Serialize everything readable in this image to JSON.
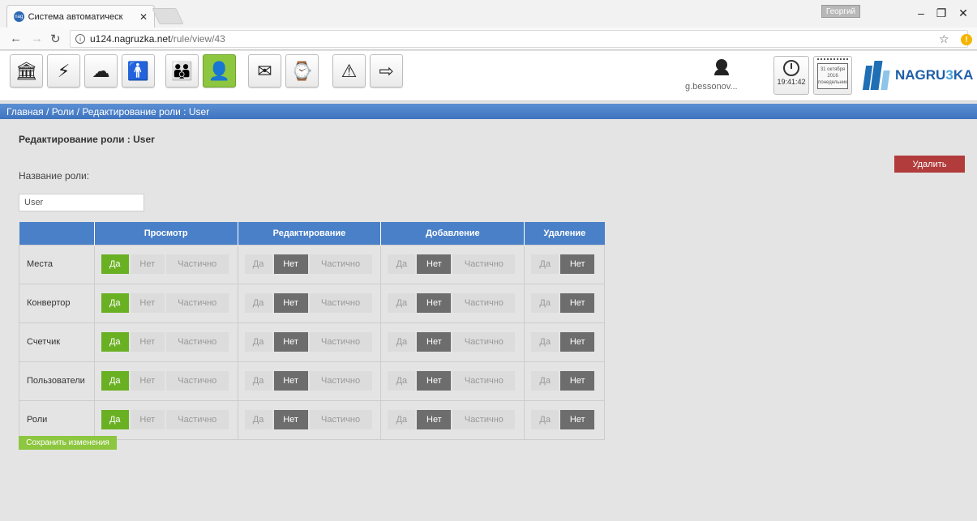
{
  "browser": {
    "tab_title": "Система автоматическ",
    "tab_favicon": "nag",
    "user_chip": "Георгий",
    "url_host": "u124.nagruzka.net",
    "url_path": "/rule/view/43"
  },
  "toolbar": {
    "icons": [
      "building-icon",
      "network-icon",
      "cloud-network-icon",
      "person-icon",
      "family-icon",
      "roles-icon",
      "mail-icon",
      "schedule-icon",
      "warning-icon",
      "logout-icon"
    ],
    "active_index": 5,
    "username": "g.bessonov...",
    "time": "19:41:42",
    "calendar_day": "31 октября",
    "calendar_year": "2016",
    "calendar_weekday": "понедельник",
    "logo_text_main": "NAGRU",
    "logo_text_accent": "3",
    "logo_text_end": "KA"
  },
  "breadcrumb": {
    "home": "Главная",
    "sep": " / ",
    "roles": "Роли",
    "current": "Редактирование роли : User"
  },
  "page": {
    "title": "Редактирование роли : User",
    "delete_label": "Удалить",
    "role_name_label": "Название роли:",
    "role_name_value": "User",
    "save_label": "Сохранить изменения"
  },
  "table": {
    "headers": [
      "",
      "Просмотр",
      "Редактирование",
      "Добавление",
      "Удаление"
    ],
    "labels": {
      "yes": "Да",
      "no": "Нет",
      "partial": "Частично"
    },
    "rows": [
      {
        "name": "Места",
        "view": "yes",
        "edit": "no",
        "add": "no",
        "delete": "no"
      },
      {
        "name": "Конвертор",
        "view": "yes",
        "edit": "no",
        "add": "no",
        "delete": "no"
      },
      {
        "name": "Счетчик",
        "view": "yes",
        "edit": "no",
        "add": "no",
        "delete": "no"
      },
      {
        "name": "Пользователи",
        "view": "yes",
        "edit": "no",
        "add": "no",
        "delete": "no"
      },
      {
        "name": "Роли",
        "view": "yes",
        "edit": "no",
        "add": "no",
        "delete": "no"
      }
    ]
  },
  "colors": {
    "accent_green": "#8dc63f",
    "selected_green": "#6ab023",
    "selected_dark": "#6d6d6d",
    "header_blue": "#4a80c8",
    "danger": "#b23b3b"
  }
}
